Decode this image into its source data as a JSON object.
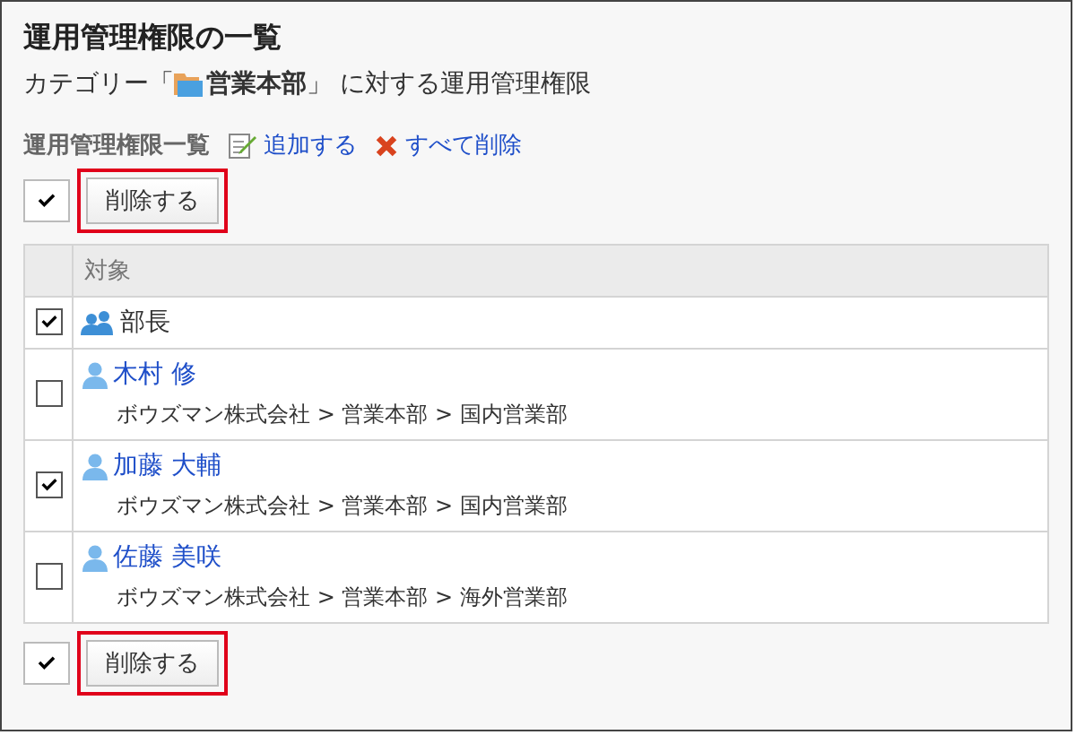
{
  "title": "運用管理権限の一覧",
  "category": {
    "prefix": "カテゴリー「",
    "name": "営業本部",
    "suffix": "」 に対する運用管理権限"
  },
  "toolbar": {
    "label": "運用管理権限一覧",
    "add": "追加する",
    "delete_all": "すべて削除"
  },
  "top_actions": {
    "delete_button": "削除する",
    "highlighted": true
  },
  "table": {
    "columns": [
      "対象"
    ],
    "rows": [
      {
        "kind": "role",
        "name": "部長",
        "checked": true
      },
      {
        "kind": "user",
        "name": "木村 修",
        "path": "ボウズマン株式会社 > 営業本部 > 国内営業部",
        "checked": false
      },
      {
        "kind": "user",
        "name": "加藤 大輔",
        "path": "ボウズマン株式会社 > 営業本部 > 国内営業部",
        "checked": true
      },
      {
        "kind": "user",
        "name": "佐藤 美咲",
        "path": "ボウズマン株式会社 > 営業本部 > 海外営業部",
        "checked": false
      }
    ]
  },
  "bottom_actions": {
    "delete_button": "削除する",
    "highlighted": true
  }
}
